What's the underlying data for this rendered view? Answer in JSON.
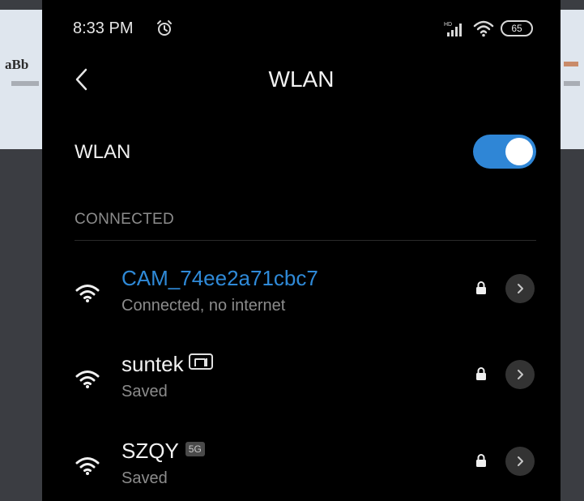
{
  "status_bar": {
    "time": "8:33 PM",
    "battery_level": "65",
    "icons": [
      "alarm-icon",
      "hd-signal-icon",
      "wifi-icon",
      "battery-icon"
    ]
  },
  "header": {
    "title": "WLAN",
    "back_icon": "chevron-left-icon"
  },
  "wlan_toggle": {
    "label": "WLAN",
    "enabled": true,
    "accent_color": "#2f86d6"
  },
  "connected_section": {
    "header": "CONNECTED"
  },
  "networks": [
    {
      "name": "CAM_74ee2a71cbc7",
      "status": "Connected, no internet",
      "secured": true,
      "connected": true,
      "badge": ""
    },
    {
      "name": "suntek",
      "status": "Saved",
      "secured": true,
      "connected": false,
      "badge": "mi-icon"
    },
    {
      "name": "SZQY",
      "status": "Saved",
      "secured": true,
      "connected": false,
      "badge": "5G"
    }
  ],
  "colors": {
    "background": "#000000",
    "connected_text": "#2f8ad8",
    "secondary_text": "#8c8c8c"
  }
}
